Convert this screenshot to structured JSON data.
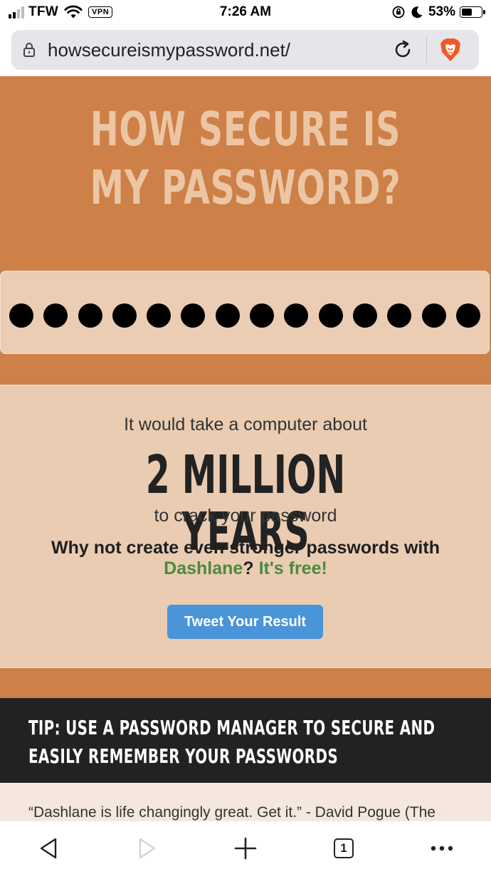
{
  "status_bar": {
    "carrier": "TFW",
    "vpn_label": "VPN",
    "time": "7:26 AM",
    "battery": "53%"
  },
  "browser": {
    "url": "howsecureismypassword.net/",
    "tab_count": "1"
  },
  "page": {
    "title": "HOW SECURE IS MY PASSWORD?",
    "password_dot_count": 14,
    "result_intro": "It would take a computer about",
    "result_time": "2 MILLION YEARS",
    "result_outro": "to crack your password",
    "cta_prefix": "Why not create even stronger passwords with",
    "cta_brand": "Dashlane",
    "cta_mid": "?",
    "cta_free": "It's free!",
    "tweet_button": "Tweet Your Result",
    "tip": "TIP: USE A PASSWORD MANAGER TO SECURE AND EASILY REMEMBER YOUR PASSWORDS",
    "quote": "“Dashlane is life changingly great. Get it.” - David Pogue (The"
  },
  "colors": {
    "hero_orange": "#cd8048",
    "title_peach": "#ecc6a4",
    "panel_peach": "#eaccb3",
    "tip_dark": "#222222",
    "dashlane_green": "#4a8a3f",
    "tweet_blue": "#4a94d8"
  },
  "icons": {
    "signal": "signal-bars-icon",
    "wifi": "wifi-icon",
    "orientation_lock": "orientation-lock-icon",
    "moon": "moon-icon",
    "battery": "battery-icon",
    "lock": "lock-icon",
    "reload": "reload-icon",
    "brave": "brave-lion-icon",
    "back": "back-arrow-icon",
    "forward": "forward-arrow-icon",
    "new_tab": "plus-icon",
    "tabs": "tabs-icon",
    "menu": "more-dots-icon"
  }
}
